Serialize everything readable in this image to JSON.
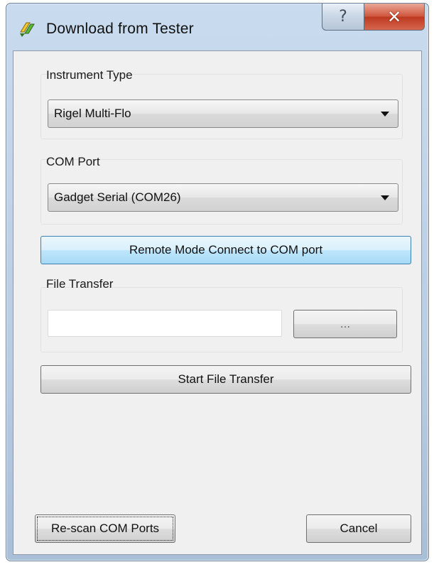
{
  "window": {
    "title": "Download from Tester",
    "help_label": "?",
    "close_label": "✕"
  },
  "instrument_type": {
    "label": "Instrument Type",
    "selected": "Rigel Multi-Flo"
  },
  "com_port": {
    "label": "COM Port",
    "selected": "Gadget Serial (COM26)"
  },
  "remote_connect_label": "Remote Mode Connect to COM port",
  "file_transfer": {
    "label": "File Transfer",
    "path_value": "",
    "browse_label": "..."
  },
  "start_transfer_label": "Start File Transfer",
  "footer": {
    "rescan_label": "Re-scan COM Ports",
    "cancel_label": "Cancel"
  },
  "colors": {
    "accent_blue": "#bee6fd",
    "close_red": "#d0573f"
  },
  "icons": {
    "app": "download-arrows-icon"
  }
}
